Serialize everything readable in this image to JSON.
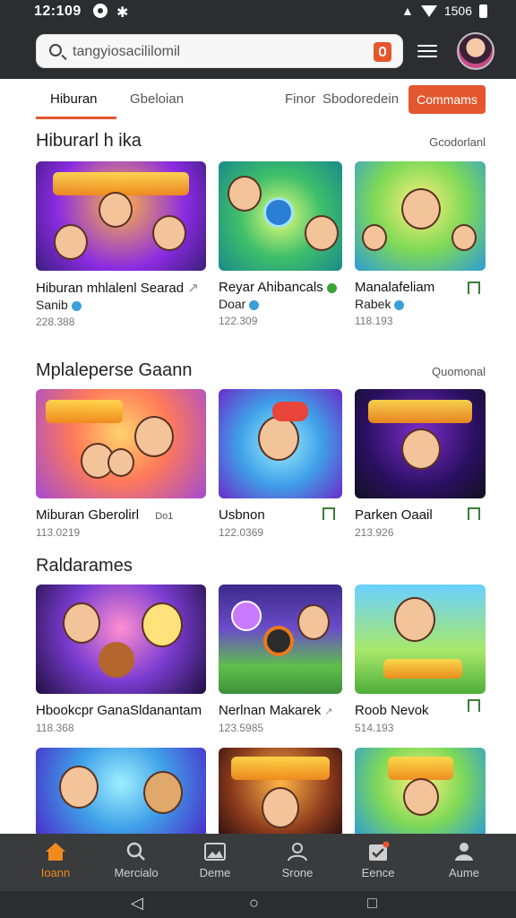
{
  "status": {
    "time": "12:109",
    "right_text": "1506"
  },
  "search": {
    "value": "tangyiosacililomil"
  },
  "tabs": [
    {
      "label": "Hiburan",
      "active": true
    },
    {
      "label": "Gbeloian",
      "active": false
    },
    {
      "label": "Finor",
      "active": false
    },
    {
      "label": "Sbodoredein",
      "active": false
    }
  ],
  "cta_label": "Commams",
  "colors": {
    "accent": "#e4572e",
    "header_bg": "#2b2d30",
    "nav_bg": "#3a3b3d",
    "nav_active": "#f08a1c"
  },
  "sections": [
    {
      "title": "Hiburarl h ika",
      "more": "Gcodorlanl",
      "cards": [
        {
          "title": "Hiburan mhlalenl Searad",
          "extra": "↗",
          "line2": "Sanib",
          "verified": "blue",
          "meta": "228.388",
          "bookmark": false
        },
        {
          "title": "Reyar Ahibancals",
          "extra": "",
          "line2": "Doar",
          "verified": "blue",
          "meta": "122.309",
          "bookmark": false
        },
        {
          "title": "Manalafeliam",
          "extra": "",
          "line2": "Rabek",
          "verified": "blue",
          "meta": "118.193",
          "bookmark": true
        }
      ]
    },
    {
      "title": "Mplaleperse Gaann",
      "more": "Quomonal",
      "cards": [
        {
          "title": "Miburan Gberolirl",
          "extra": "Do1",
          "line2": "",
          "verified": "",
          "meta": "113.0219",
          "bookmark": false
        },
        {
          "title": "Usbnon",
          "extra": "",
          "line2": "",
          "verified": "",
          "meta": "122.0369",
          "bookmark": true
        },
        {
          "title": "Parken Oaail",
          "extra": "",
          "line2": "",
          "verified": "",
          "meta": "213.926",
          "bookmark": true
        }
      ]
    },
    {
      "title": "Raldarames",
      "more": "",
      "cards": [
        {
          "title": "Hbookcpr GanaSldanantam",
          "extra": "",
          "line2": "",
          "verified": "",
          "meta": "118.368",
          "bookmark": false
        },
        {
          "title": "Nerlnan Makarek",
          "extra": "↗",
          "line2": "",
          "verified": "",
          "meta": "123.5985",
          "bookmark": false
        },
        {
          "title": "Roob Nevok",
          "extra": "",
          "line2": "",
          "verified": "",
          "meta": "514.193",
          "bookmark": true
        }
      ]
    }
  ],
  "nav": [
    {
      "label": "Ioann",
      "icon": "home-icon",
      "active": true
    },
    {
      "label": "Mercialo",
      "icon": "search-icon",
      "active": false
    },
    {
      "label": "Deme",
      "icon": "image-icon",
      "active": false
    },
    {
      "label": "Srone",
      "icon": "person-icon",
      "active": false
    },
    {
      "label": "Eence",
      "icon": "notification-icon",
      "active": false
    },
    {
      "label": "Aume",
      "icon": "account-icon",
      "active": false
    }
  ]
}
